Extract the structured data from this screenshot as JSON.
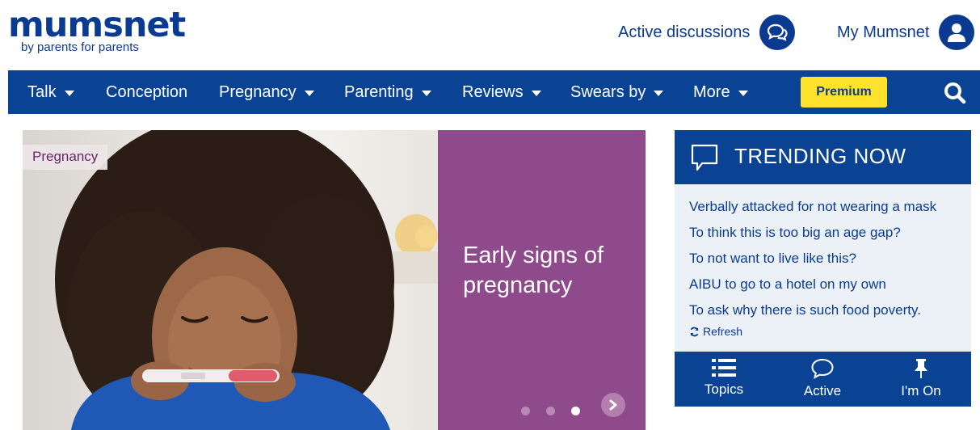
{
  "header": {
    "logo_word": "mumsnet",
    "logo_tagline": "by parents for parents",
    "active_discussions_label": "Active discussions",
    "my_mumsnet_label": "My Mumsnet"
  },
  "nav": {
    "items": [
      {
        "label": "Talk",
        "has_dropdown": true
      },
      {
        "label": "Conception",
        "has_dropdown": false
      },
      {
        "label": "Pregnancy",
        "has_dropdown": true
      },
      {
        "label": "Parenting",
        "has_dropdown": true
      },
      {
        "label": "Reviews",
        "has_dropdown": true
      },
      {
        "label": "Swears by",
        "has_dropdown": true
      },
      {
        "label": "More",
        "has_dropdown": true
      }
    ],
    "premium_label": "Premium",
    "search_icon": "search-icon"
  },
  "hero": {
    "category_tag": "Pregnancy",
    "title": "Early signs of pregnancy",
    "slide_count": 3,
    "current_slide": 3
  },
  "trending": {
    "title": "TRENDING NOW",
    "links": [
      "Verbally attacked for not wearing a mask",
      "To think this is too big an age gap?",
      "To not want to live like this?",
      "AIBU to go to a hotel on my own",
      "To ask why there is such food poverty."
    ],
    "refresh_label": "Refresh",
    "footer": [
      {
        "label": "Topics",
        "icon": "list-icon"
      },
      {
        "label": "Active",
        "icon": "speech-bubble-icon"
      },
      {
        "label": "I'm On",
        "icon": "pin-icon"
      }
    ]
  },
  "colors": {
    "brand_blue": "#0b4394",
    "premium_yellow": "#ffe22c",
    "hero_purple": "#8e4a8b"
  }
}
